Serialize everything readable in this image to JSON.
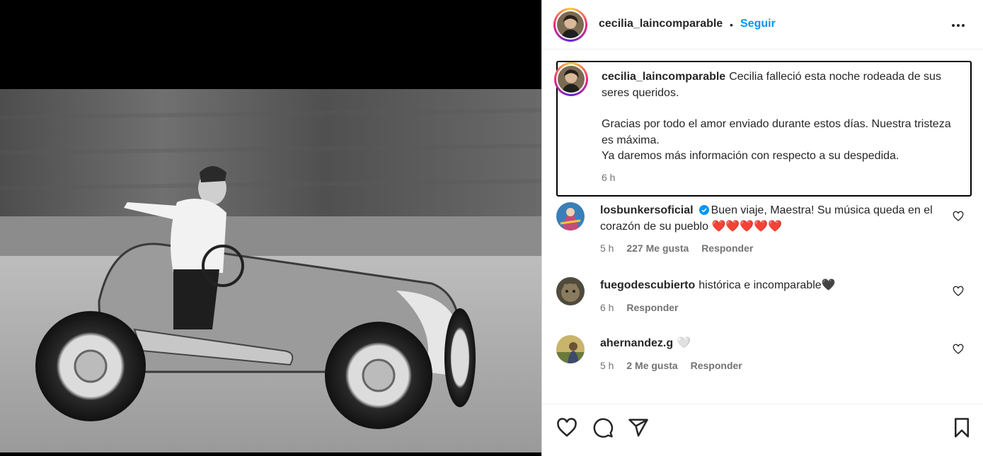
{
  "post": {
    "username": "cecilia_laincomparable",
    "separator": "•",
    "follow_label": "Seguir",
    "more_icon": "more-horizontal-icon"
  },
  "caption": {
    "username": "cecilia_laincomparable",
    "line1": "Cecilia falleció esta noche rodeada de sus seres queridos.",
    "line2": "Gracias por todo el amor enviado durante estos días. Nuestra tristeza es máxima.",
    "line3": "Ya daremos más información con respecto a su despedida.",
    "time": "6 h"
  },
  "comments": [
    {
      "username": "losbunkersoficial",
      "verified": true,
      "text": "Buen viaje, Maestra! Su música queda en el corazón de su pueblo ❤️❤️❤️❤️❤️",
      "time": "5 h",
      "likes": "227 Me gusta",
      "reply": "Responder"
    },
    {
      "username": "fuegodescubierto",
      "text": "histórica e incomparable🖤",
      "time": "6 h",
      "reply": "Responder"
    },
    {
      "username": "ahernandez.g",
      "text": "🤍",
      "time": "5 h",
      "likes": "2 Me gusta",
      "reply": "Responder"
    }
  ],
  "actions": {
    "like_icon": "heart-icon",
    "comment_icon": "comment-icon",
    "share_icon": "share-icon",
    "save_icon": "bookmark-icon"
  },
  "colors": {
    "accent": "#0095f6",
    "text": "#262626",
    "muted": "#737373",
    "heart_red": "#e0143c"
  }
}
